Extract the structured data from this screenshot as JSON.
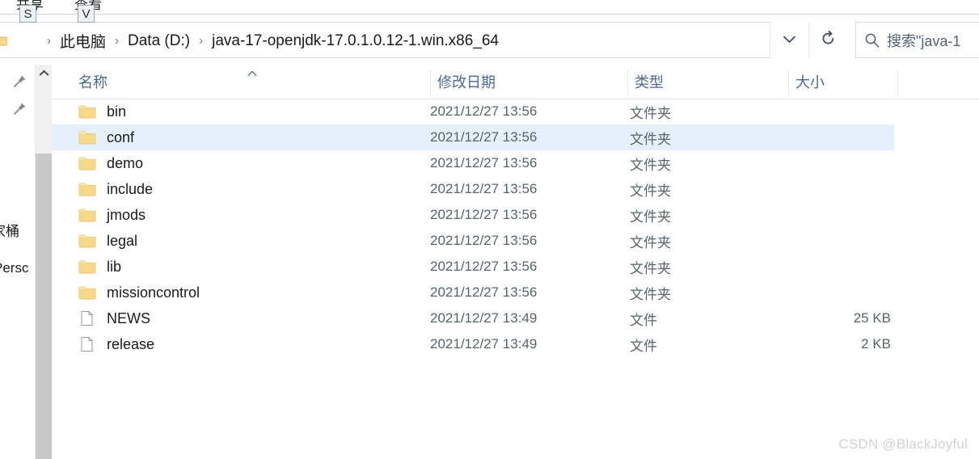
{
  "ribbon": {
    "tabs": [
      {
        "label": "共享",
        "keytip": "S"
      },
      {
        "label": "查看",
        "keytip": "V"
      }
    ]
  },
  "address_bar": {
    "folder_icon": "folder-icon",
    "breadcrumbs": [
      {
        "label": "此电脑"
      },
      {
        "label": "Data (D:)"
      },
      {
        "label": "java-17-openjdk-17.0.1.0.12-1.win.x86_64"
      }
    ],
    "separator": "›",
    "dropdown_icon": "chevron-down-icon",
    "refresh_icon": "refresh-icon"
  },
  "search": {
    "icon": "search-icon",
    "placeholder": "搜索\"java-1"
  },
  "nav_pane": {
    "items": [
      {
        "icon": "pin-icon",
        "label": ""
      },
      {
        "icon": "pin-icon",
        "label": ""
      },
      {
        "icon": "",
        "label": "家桶"
      },
      {
        "icon": "",
        "label": "Persc"
      }
    ],
    "scrollbar": {
      "up_arrow_icon": "chevron-up-icon"
    }
  },
  "file_list": {
    "columns": [
      {
        "label": "名称",
        "sort": "ascending"
      },
      {
        "label": "修改日期",
        "sort": ""
      },
      {
        "label": "类型",
        "sort": ""
      },
      {
        "label": "大小",
        "sort": ""
      }
    ],
    "sort_caret_icon": "caret-up-icon",
    "rows": [
      {
        "name": "bin",
        "icon": "folder-icon",
        "date": "2021/12/27 13:56",
        "type": "文件夹",
        "size": "",
        "selected": false
      },
      {
        "name": "conf",
        "icon": "folder-icon",
        "date": "2021/12/27 13:56",
        "type": "文件夹",
        "size": "",
        "selected": true
      },
      {
        "name": "demo",
        "icon": "folder-icon",
        "date": "2021/12/27 13:56",
        "type": "文件夹",
        "size": "",
        "selected": false
      },
      {
        "name": "include",
        "icon": "folder-icon",
        "date": "2021/12/27 13:56",
        "type": "文件夹",
        "size": "",
        "selected": false
      },
      {
        "name": "jmods",
        "icon": "folder-icon",
        "date": "2021/12/27 13:56",
        "type": "文件夹",
        "size": "",
        "selected": false
      },
      {
        "name": "legal",
        "icon": "folder-icon",
        "date": "2021/12/27 13:56",
        "type": "文件夹",
        "size": "",
        "selected": false
      },
      {
        "name": "lib",
        "icon": "folder-icon",
        "date": "2021/12/27 13:56",
        "type": "文件夹",
        "size": "",
        "selected": false
      },
      {
        "name": "missioncontrol",
        "icon": "folder-icon",
        "date": "2021/12/27 13:56",
        "type": "文件夹",
        "size": "",
        "selected": false
      },
      {
        "name": "NEWS",
        "icon": "file-icon",
        "date": "2021/12/27 13:49",
        "type": "文件",
        "size": "25 KB",
        "selected": false
      },
      {
        "name": "release",
        "icon": "file-icon",
        "date": "2021/12/27 13:49",
        "type": "文件",
        "size": "2 KB",
        "selected": false
      }
    ]
  },
  "watermark": {
    "text": "CSDN @BlackJoyful"
  },
  "colors": {
    "selection": "#e4f0fc",
    "column_header_text": "#4e6a94",
    "folder": "#f7d98a",
    "scrollbar_thumb": "#c8c8c8",
    "watermark": "#d2d2d2"
  }
}
